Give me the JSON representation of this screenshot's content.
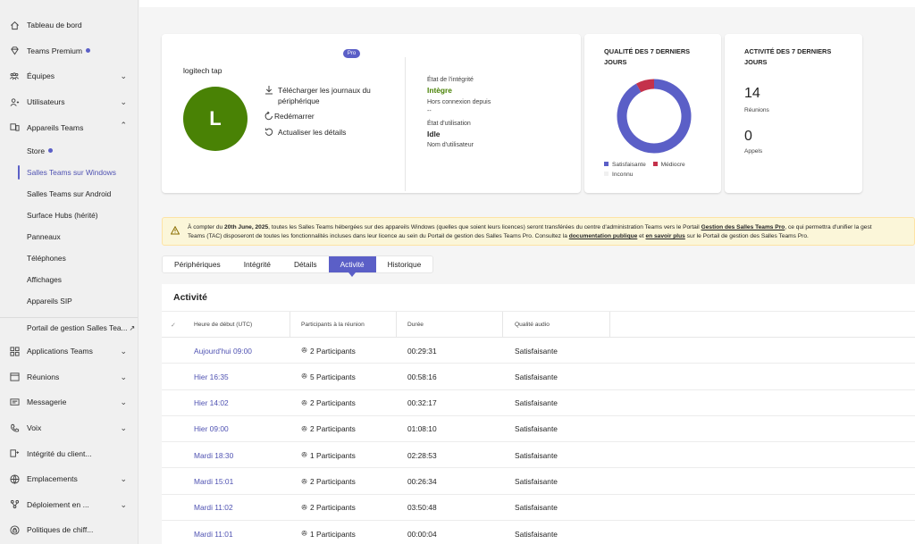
{
  "sidebar": {
    "items": [
      {
        "label": "Tableau de bord",
        "icon": "home-icon"
      },
      {
        "label": "Teams Premium",
        "icon": "diamond-icon",
        "dot": true
      },
      {
        "label": "Équipes",
        "icon": "teams-icon",
        "chevron": "down"
      },
      {
        "label": "Utilisateurs",
        "icon": "users-icon",
        "chevron": "down"
      },
      {
        "label": "Appareils Teams",
        "icon": "devices-icon",
        "chevron": "up"
      }
    ],
    "subitems": [
      {
        "label": "Store",
        "dot": true
      },
      {
        "label": "Salles Teams sur Windows",
        "active": true
      },
      {
        "label": "Salles Teams sur Android"
      },
      {
        "label": "Surface Hubs (hérité)"
      },
      {
        "label": "Panneaux"
      },
      {
        "label": "Téléphones"
      },
      {
        "label": "Affichages"
      },
      {
        "label": "Appareils SIP"
      },
      {
        "label": "Portail de gestion Salles Tea..."
      }
    ],
    "items2": [
      {
        "label": "Applications Teams",
        "icon": "apps-icon",
        "chevron": "down"
      },
      {
        "label": "Réunions",
        "icon": "calendar-icon",
        "chevron": "down"
      },
      {
        "label": "Messagerie",
        "icon": "chat-icon",
        "chevron": "down"
      },
      {
        "label": "Voix",
        "icon": "phone-icon",
        "chevron": "down"
      },
      {
        "label": "Intégrité du client...",
        "icon": "health-icon"
      },
      {
        "label": "Emplacements",
        "icon": "globe-icon",
        "chevron": "down"
      },
      {
        "label": "Déploiement en ...",
        "icon": "deploy-icon",
        "chevron": "down"
      },
      {
        "label": "Politiques de chiff...",
        "icon": "policy-icon"
      }
    ]
  },
  "device": {
    "badge": "Pro",
    "name": "logitech tap",
    "avatar_letter": "L",
    "avatar_color": "#498205",
    "actions": {
      "download_line1": "Télécharger les journaux du",
      "download_line2": "périphérique",
      "restart": "Redémarrer",
      "refresh": "Actualiser les détails"
    },
    "health_label": "État de l'intégrité",
    "health_value": "Intègre",
    "offline_label": "Hors connexion depuis",
    "offline_value": "--",
    "usage_label": "État d'utilisation",
    "usage_value": "Idle",
    "username_label": "Nom d'utilisateur"
  },
  "quality": {
    "title": "Qualité des 7 derniers jours",
    "legend": [
      {
        "label": "Satisfaisante",
        "color": "#5b5fc7"
      },
      {
        "label": "Médiocre",
        "color": "#c4314b"
      },
      {
        "label": "Inconnu",
        "color": "#f0f0f0"
      }
    ],
    "chart_data": {
      "type": "pie",
      "categories": [
        "Satisfaisante",
        "Médiocre",
        "Inconnu"
      ],
      "values": [
        92,
        8,
        0
      ]
    }
  },
  "activity_summary": {
    "title": "Activité des 7 derniers jours",
    "meetings_count": "14",
    "meetings_label": "Réunions",
    "calls_count": "0",
    "calls_label": "Appels"
  },
  "banner": {
    "part1": "À compter du ",
    "date": "20th June, 2025",
    "part2": ", toutes les Salles Teams hébergées sur des appareils Windows (quelles que soient leurs licences) seront transférées du centre d'administration Teams vers le Portail ",
    "link1": "Gestion des Salles Teams Pro",
    "part3": ", ce qui permettra d'unifier la gest",
    "line2_part1": "Teams (TAC) disposeront de toutes les fonctionnalités incluses dans leur licence au sein du Portail de gestion des Salles Teams Pro. Consultez la ",
    "link2": "documentation publique",
    "line2_part2": " et ",
    "link3": "en savoir plus",
    "line2_part3": " sur le Portail de gestion des Salles Teams Pro."
  },
  "tabs": [
    "Périphériques",
    "Intégrité",
    "Détails",
    "Activité",
    "Historique"
  ],
  "table": {
    "title": "Activité",
    "columns": [
      "Heure de début (UTC)",
      "Participants à la réunion",
      "Durée",
      "Qualité audio"
    ],
    "rows": [
      {
        "start": "Aujourd'hui 09:00",
        "participants": "2 Participants",
        "duration": "00:29:31",
        "quality": "Satisfaisante"
      },
      {
        "start": "Hier 16:35",
        "participants": "5 Participants",
        "duration": "00:58:16",
        "quality": "Satisfaisante"
      },
      {
        "start": "Hier 14:02",
        "participants": "2 Participants",
        "duration": "00:32:17",
        "quality": "Satisfaisante"
      },
      {
        "start": "Hier 09:00",
        "participants": "2 Participants",
        "duration": "01:08:10",
        "quality": "Satisfaisante"
      },
      {
        "start": "Mardi 18:30",
        "participants": "1 Participants",
        "duration": "02:28:53",
        "quality": "Satisfaisante"
      },
      {
        "start": "Mardi 15:01",
        "participants": "2 Participants",
        "duration": "00:26:34",
        "quality": "Satisfaisante"
      },
      {
        "start": "Mardi 11:02",
        "participants": "2 Participants",
        "duration": "03:50:48",
        "quality": "Satisfaisante"
      },
      {
        "start": "Mardi 11:01",
        "participants": "1 Participants",
        "duration": "00:00:04",
        "quality": "Satisfaisante"
      }
    ]
  }
}
